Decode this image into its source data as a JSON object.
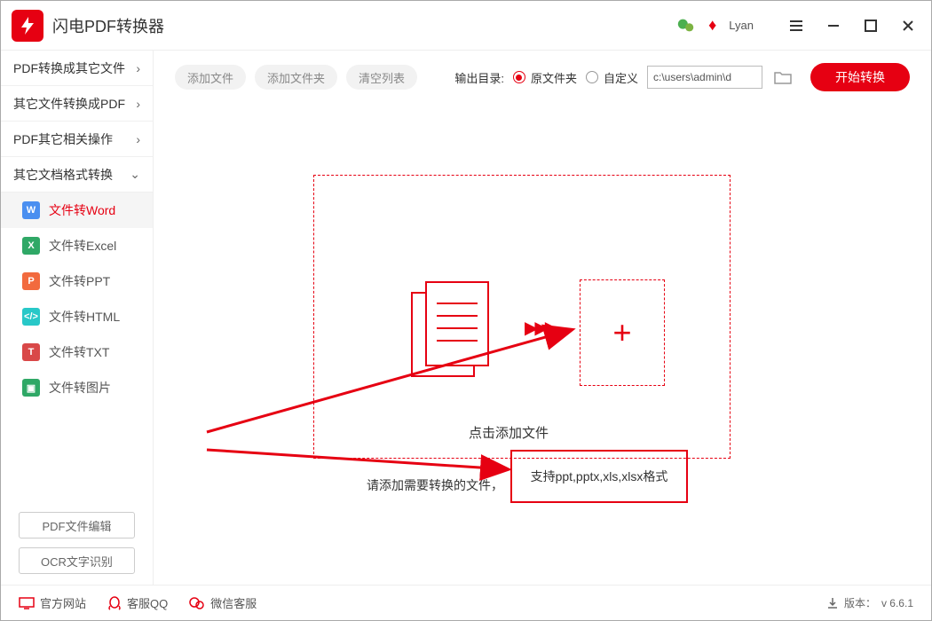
{
  "app": {
    "title": "闪电PDF转换器",
    "username": "Lyan"
  },
  "sidebar": {
    "cats": [
      {
        "label": "PDF转换成其它文件"
      },
      {
        "label": "其它文件转换成PDF"
      },
      {
        "label": "PDF其它相关操作"
      },
      {
        "label": "其它文档格式转换"
      }
    ],
    "subs": [
      {
        "label": "文件转Word",
        "ico": "W"
      },
      {
        "label": "文件转Excel",
        "ico": "X"
      },
      {
        "label": "文件转PPT",
        "ico": "P"
      },
      {
        "label": "文件转HTML",
        "ico": "</>"
      },
      {
        "label": "文件转TXT",
        "ico": "T"
      },
      {
        "label": "文件转图片",
        "ico": "▣"
      }
    ],
    "bottom": [
      {
        "label": "PDF文件编辑"
      },
      {
        "label": "OCR文字识别"
      }
    ]
  },
  "toolbar": {
    "add_file": "添加文件",
    "add_folder": "添加文件夹",
    "clear": "清空列表",
    "output_label": "输出目录:",
    "radio_original": "原文件夹",
    "radio_custom": "自定义",
    "path": "c:\\users\\admin\\d",
    "start": "开始转换"
  },
  "drop": {
    "click_text": "点击添加文件",
    "hint_prefix": "请添加需要转换的文件，",
    "hint_box": "支持ppt,pptx,xls,xlsx格式"
  },
  "footer": {
    "site": "官方网站",
    "qq": "客服QQ",
    "wechat": "微信客服",
    "version_label": "版本：",
    "version": "v 6.6.1"
  }
}
